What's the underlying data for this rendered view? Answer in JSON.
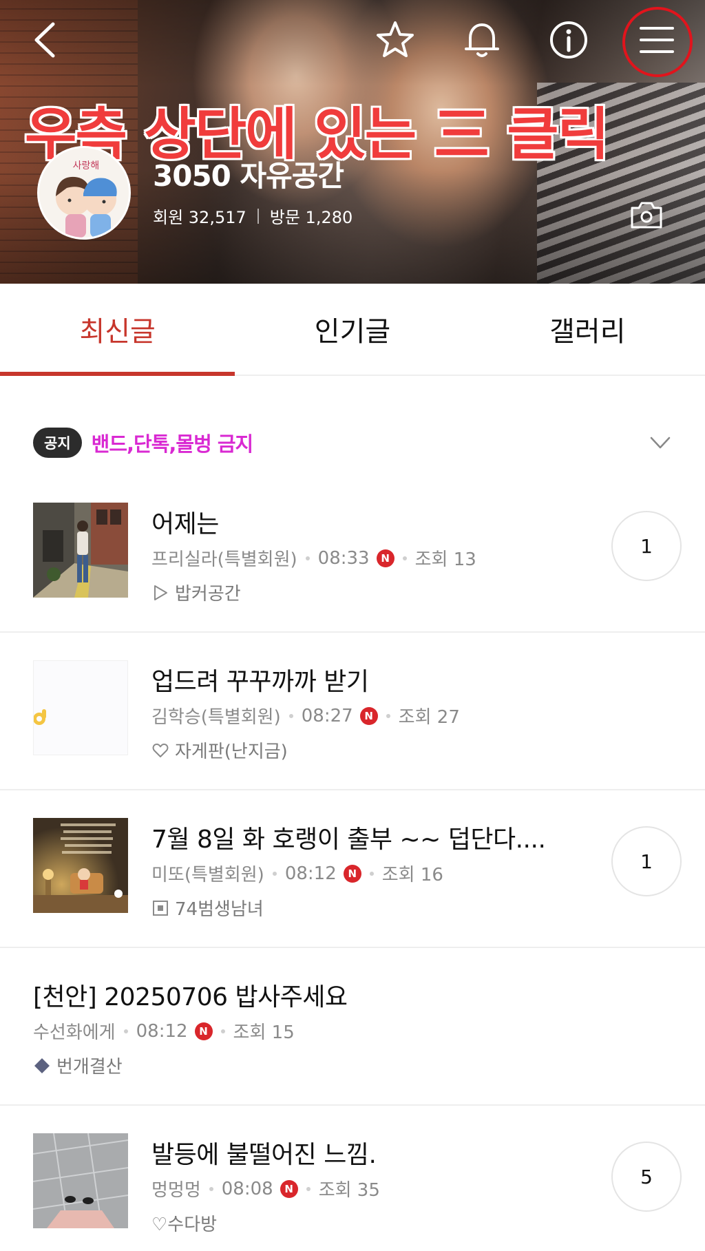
{
  "header": {
    "banner_text": "우측 상단에 있는 三 클릭",
    "cafe_name": "3050 자유공간",
    "members_label": "회원 32,517",
    "visits_label": "방문 1,280",
    "avatar_caption": "사랑해"
  },
  "tabs": [
    {
      "label": "최신글",
      "active": true
    },
    {
      "label": "인기글",
      "active": false
    },
    {
      "label": "갤러리",
      "active": false
    }
  ],
  "notice": {
    "badge": "공지",
    "text": "밴드,단톡,몰벙 금지"
  },
  "posts": [
    {
      "title": "어제는",
      "author": "프리실라(특별회원)",
      "time": "08:33",
      "new_badge": "N",
      "views": "조회 13",
      "board_icon": "play-outline-icon",
      "board": "밥커공간",
      "comments": "1",
      "thumbnail": "street-photo"
    },
    {
      "title": "업드려 꾸꾸까까 받기",
      "author": "김학승(특별회원)",
      "time": "08:27",
      "new_badge": "N",
      "views": "조회 27",
      "board_icon": "heart-outline-icon",
      "board": "자게판(난지금)",
      "comments": null,
      "thumbnail": "ok-hand-emoji"
    },
    {
      "title": "7월 8일 화 호랭이 출부 ~~ 덥단다....",
      "author": "미또(특별회원)",
      "time": "08:12",
      "new_badge": "N",
      "views": "조회 16",
      "board_icon": "square-box-icon",
      "board": "74범생남녀",
      "comments": "1",
      "thumbnail": "cartoon-room"
    },
    {
      "title": "[천안] 20250706 밥사주세요",
      "author": "수선화에게",
      "time": "08:12",
      "new_badge": "N",
      "views": "조회 15",
      "board_icon": "diamond-icon",
      "board": "번개결산",
      "comments": null,
      "thumbnail": null
    },
    {
      "title": "발등에 불떨어진 느낌.",
      "author": "멍멍멍",
      "time": "08:08",
      "new_badge": "N",
      "views": "조회 35",
      "board_icon": "heart-outline-icon",
      "board": "♡수다방",
      "comments": "5",
      "thumbnail": "pavement-feet"
    }
  ],
  "colors": {
    "accent": "#c7362c",
    "notice_text": "#d929d2",
    "new_badge": "#d9262b",
    "highlight_ring": "#e1141c"
  }
}
